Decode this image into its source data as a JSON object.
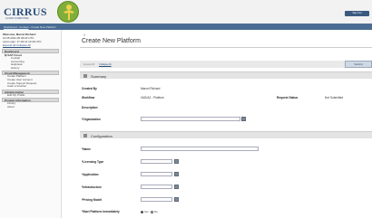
{
  "brand": {
    "name": "CIRRUS",
    "subtitle": "CLOUD COMPUTING",
    "logo_icon": "figure-icon",
    "colors": {
      "brand_blue": "#2b4f7a",
      "logo_green": "#7fae3a"
    }
  },
  "header": {
    "top_button": "Sign Out"
  },
  "breadcrumb": {
    "link": "Dashboard : Contact",
    "current": "› Create New Platform"
  },
  "sidebar": {
    "user_line1": "Welcome, Marcel Richard",
    "user_line2": "14:35 2011-05 09:22 UTC",
    "user_line3": "Last Login: 17-04-11 13:40 UTC",
    "links": "Expand All   Collapse All",
    "sections": [
      {
        "title": "Dashboard"
      },
      {
        "title": "Cloud Management"
      },
      {
        "title": "Administration"
      },
      {
        "title": "Product Information"
      }
    ],
    "sap_cloud": "⊟ SAP Cloud",
    "sap_items": [
      "Cockpit",
      "Accounting",
      "Helpdesk",
      "History"
    ],
    "cloud_items": [
      "Create Platform",
      "Create User Account",
      "Create Support Request",
      "Cash a Voucher"
    ],
    "admin_items": [
      "Edit My Profile"
    ],
    "product_items": [
      "Library",
      "About"
    ]
  },
  "page": {
    "slash": "//",
    "title": "Create New Platform",
    "toolbar_expand": "Expand All",
    "toolbar_collapse": "Collapse All",
    "submit": "Submit"
  },
  "summary": {
    "heading": "Summary",
    "created_by_label": "Created By",
    "created_by_value": "Marcel Richard",
    "workflow_label": "Workflow",
    "workflow_value": "VAD/AZ - Platform",
    "request_status_label": "Request Status",
    "request_status_value": "Not Submitted",
    "description_label": "Description",
    "organization_label": "*Organization"
  },
  "configuration": {
    "heading": "Configuration",
    "name_label": "*Name",
    "licensing_label": "*Licensing Type",
    "application_label": "*Application",
    "infrastructure_label": "*Infrastructure",
    "pricing_label": "*Pricing Model",
    "start_label": "*Start Platform Immediately",
    "yes_label": "Yes",
    "no_label": "No",
    "start_selected": "Yes"
  }
}
